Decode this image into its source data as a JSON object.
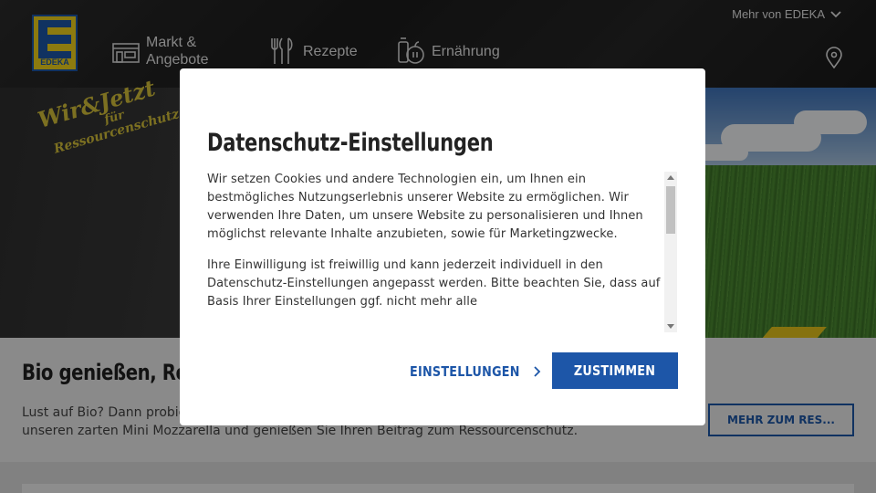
{
  "header": {
    "logo_text": "EDEKA",
    "nav": [
      {
        "label": "Markt & Angebote",
        "icon": "store-icon"
      },
      {
        "label": "Rezepte",
        "icon": "cutlery-icon"
      },
      {
        "label": "Ernährung",
        "icon": "nutrition-icon"
      }
    ],
    "more_label": "Mehr von EDEKA",
    "location_icon": "location-pin-icon"
  },
  "hero": {
    "campaign_line1": "Wir&Jetzt",
    "campaign_line2": "für",
    "campaign_line3": "Ressourcenschutz"
  },
  "content": {
    "title": "Bio genießen, Res",
    "text": "Lust auf Bio? Dann probie\nunseren zarten Mini Mozzarella und genießen Sie Ihren Beitrag zum Ressourcenschutz.",
    "button_label": "MEHR ZUM RES..."
  },
  "modal": {
    "title": "Datenschutz-Einstellungen",
    "paragraph1": "Wir setzen Cookies und andere Technologien ein, um Ihnen ein bestmögliches Nutzungserlebnis unserer Website zu ermöglichen.  Wir verwenden Ihre Daten, um unsere Website zu personalisieren und Ihnen möglichst relevante Inhalte anzubieten, sowie für Marketingzwecke.",
    "paragraph2": "Ihre Einwilligung ist freiwillig und kann jederzeit individuell in den Datenschutz-Einstellungen angepasst werden. Bitte beachten Sie, dass auf Basis Ihrer Einstellungen ggf. nicht mehr alle",
    "settings_label": "EINSTELLUNGEN",
    "accept_label": "ZUSTIMMEN"
  },
  "colors": {
    "brand_blue": "#1d56a8",
    "brand_yellow": "#f2d31a",
    "header_dark": "#222222"
  }
}
